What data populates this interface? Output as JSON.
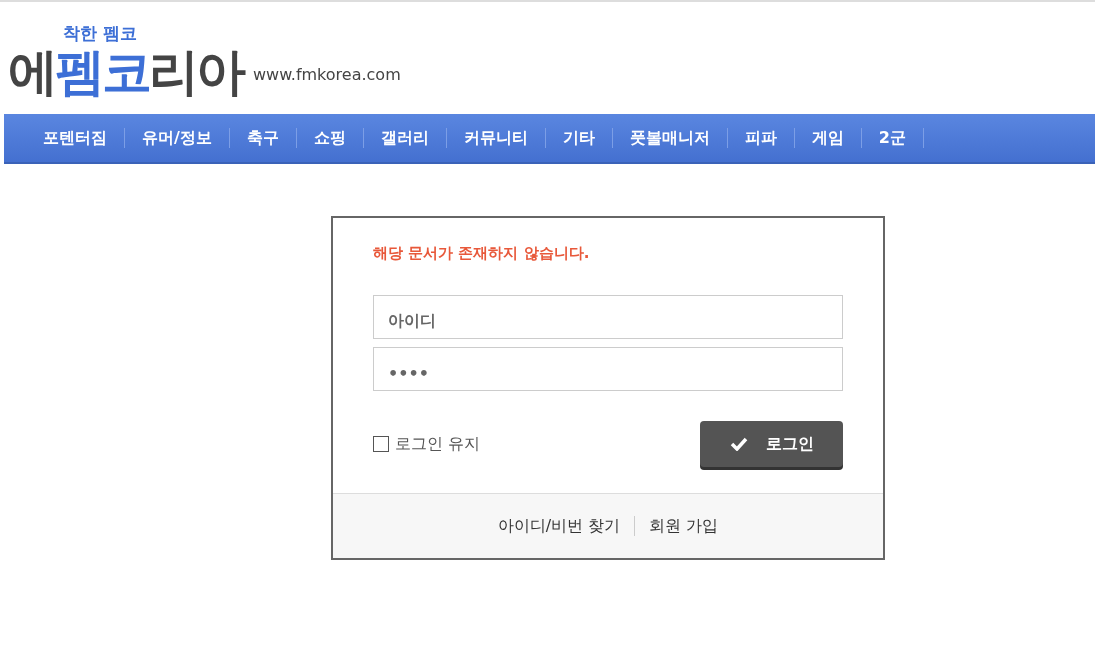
{
  "logo": {
    "tagline": "착한 펨코",
    "parts": [
      {
        "text": "에",
        "color": "#444444"
      },
      {
        "text": "펨코",
        "color": "#3d6fd6"
      },
      {
        "text": "리아",
        "color": "#444444"
      }
    ],
    "domain": "www.fmkorea.com"
  },
  "nav": {
    "items": [
      {
        "label": "포텐터짐"
      },
      {
        "label": "유머/정보"
      },
      {
        "label": "축구"
      },
      {
        "label": "쇼핑"
      },
      {
        "label": "갤러리"
      },
      {
        "label": "커뮤니티"
      },
      {
        "label": "기타"
      },
      {
        "label": "풋볼매니저"
      },
      {
        "label": "피파"
      },
      {
        "label": "게임"
      },
      {
        "label": "2군"
      }
    ]
  },
  "login": {
    "error": "해당 문서가 존재하지 않습니다.",
    "id_field": {
      "value": "아이디"
    },
    "password_field": {
      "value": "••••"
    },
    "keep_login": {
      "label": "로그인 유지",
      "checked": false
    },
    "button": {
      "label": "로그인"
    },
    "links": [
      "아이디/비번 찾기",
      "회원 가입"
    ]
  }
}
